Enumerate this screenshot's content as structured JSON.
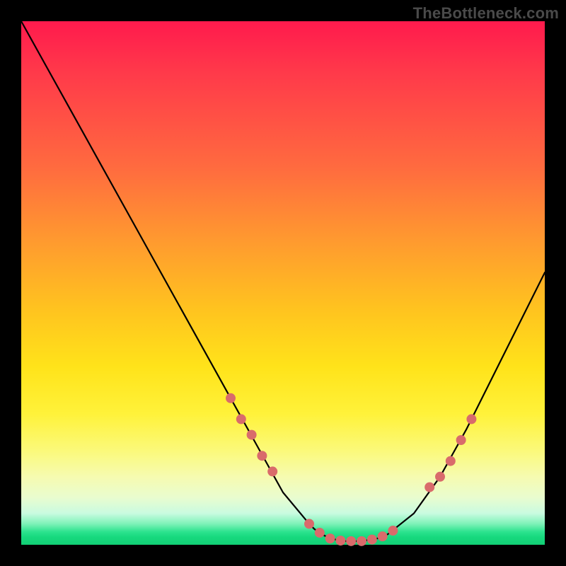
{
  "watermark": {
    "text": "TheBottleneck.com"
  },
  "colors": {
    "curve_stroke": "#000000",
    "marker_fill": "#d96b6b",
    "marker_stroke": "#d96b6b"
  },
  "chart_data": {
    "type": "line",
    "title": "",
    "xlabel": "",
    "ylabel": "",
    "xlim": [
      0,
      100
    ],
    "ylim": [
      0,
      100
    ],
    "grid": false,
    "legend": false,
    "x": [
      0,
      5,
      10,
      15,
      20,
      25,
      30,
      35,
      40,
      45,
      50,
      55,
      56,
      57,
      58,
      60,
      62,
      65,
      68,
      70,
      75,
      80,
      85,
      90,
      95,
      100
    ],
    "values": [
      100,
      91,
      82,
      73,
      64,
      55,
      46,
      37,
      28,
      19,
      10,
      4,
      3,
      2.3,
      1.7,
      1,
      0.7,
      0.7,
      1.2,
      2,
      6,
      13,
      22,
      32,
      42,
      52
    ],
    "series": [
      {
        "name": "bottleneck-curve",
        "x": [
          0,
          5,
          10,
          15,
          20,
          25,
          30,
          35,
          40,
          45,
          50,
          55,
          56,
          57,
          58,
          60,
          62,
          65,
          68,
          70,
          75,
          80,
          85,
          90,
          95,
          100
        ],
        "y": [
          100,
          91,
          82,
          73,
          64,
          55,
          46,
          37,
          28,
          19,
          10,
          4,
          3,
          2.3,
          1.7,
          1,
          0.7,
          0.7,
          1.2,
          2,
          6,
          13,
          22,
          32,
          42,
          52
        ]
      }
    ],
    "markers": [
      {
        "x": 40,
        "y": 28
      },
      {
        "x": 42,
        "y": 24
      },
      {
        "x": 44,
        "y": 21
      },
      {
        "x": 46,
        "y": 17
      },
      {
        "x": 48,
        "y": 14
      },
      {
        "x": 55,
        "y": 4
      },
      {
        "x": 57,
        "y": 2.3
      },
      {
        "x": 59,
        "y": 1.2
      },
      {
        "x": 61,
        "y": 0.8
      },
      {
        "x": 63,
        "y": 0.7
      },
      {
        "x": 65,
        "y": 0.7
      },
      {
        "x": 67,
        "y": 1
      },
      {
        "x": 69,
        "y": 1.6
      },
      {
        "x": 71,
        "y": 2.7
      },
      {
        "x": 78,
        "y": 11
      },
      {
        "x": 80,
        "y": 13
      },
      {
        "x": 82,
        "y": 16
      },
      {
        "x": 84,
        "y": 20
      },
      {
        "x": 86,
        "y": 24
      }
    ]
  }
}
